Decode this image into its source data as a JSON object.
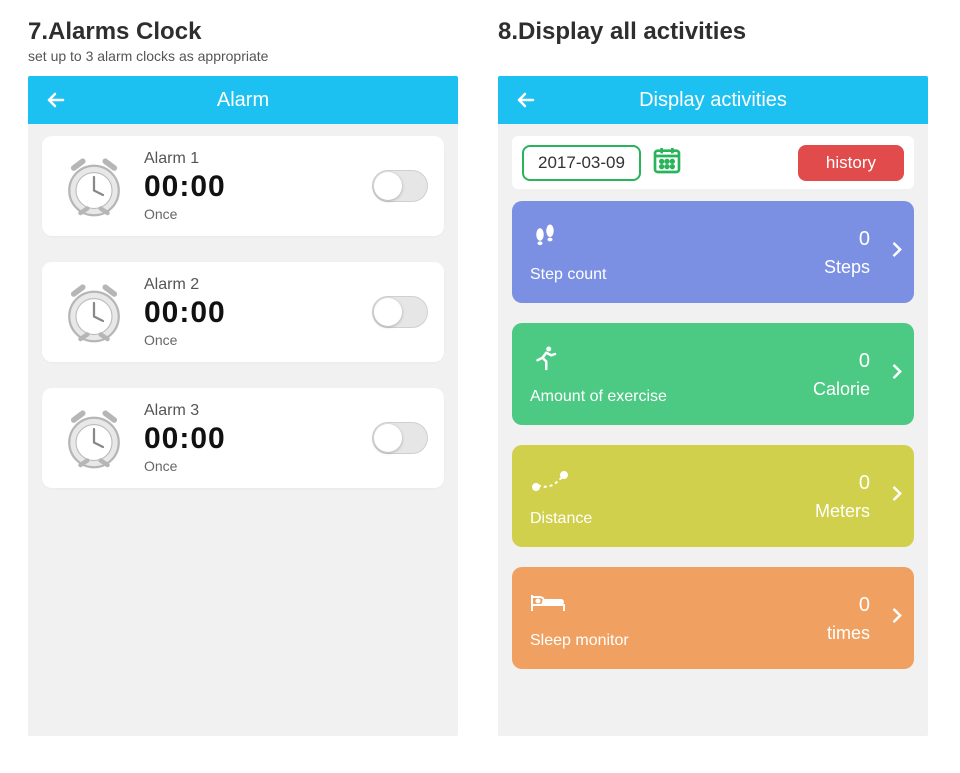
{
  "section7": {
    "title": "7.Alarms Clock",
    "subtitle": "set up to 3 alarm clocks as appropriate",
    "screen_title": "Alarm",
    "alarms": [
      {
        "name": "Alarm 1",
        "time": "00:00",
        "repeat": "Once"
      },
      {
        "name": "Alarm 2",
        "time": "00:00",
        "repeat": "Once"
      },
      {
        "name": "Alarm 3",
        "time": "00:00",
        "repeat": "Once"
      }
    ]
  },
  "section8": {
    "title": "8.Display all activities",
    "screen_title": "Display activities",
    "date": "2017-03-09",
    "history_label": "history",
    "activities": [
      {
        "label": "Step count",
        "value": "0",
        "unit": "Steps",
        "color": "blue"
      },
      {
        "label": "Amount of exercise",
        "value": "0",
        "unit": "Calorie",
        "color": "green"
      },
      {
        "label": "Distance",
        "value": "0",
        "unit": "Meters",
        "color": "yellow"
      },
      {
        "label": "Sleep monitor",
        "value": "0",
        "unit": "times",
        "color": "orange"
      }
    ]
  }
}
